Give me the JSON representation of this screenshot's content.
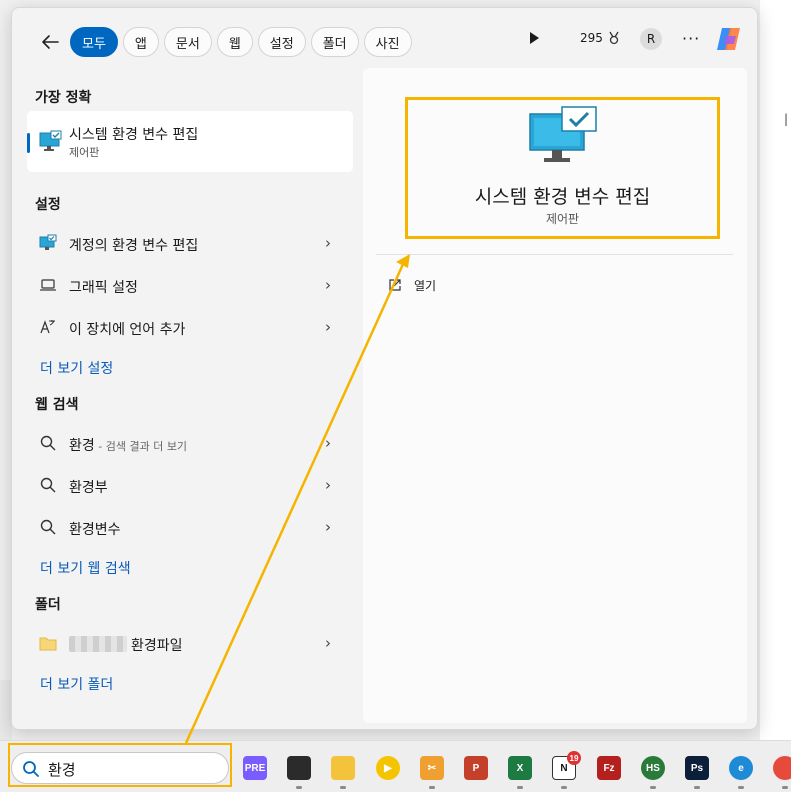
{
  "header": {
    "back_icon": "back-arrow-icon",
    "filters": [
      {
        "label": "모두",
        "active": true
      },
      {
        "label": "앱",
        "active": false
      },
      {
        "label": "문서",
        "active": false
      },
      {
        "label": "웹",
        "active": false
      },
      {
        "label": "설정",
        "active": false
      },
      {
        "label": "폴더",
        "active": false
      },
      {
        "label": "사진",
        "active": false
      }
    ],
    "points": "295",
    "avatar_letter": "R"
  },
  "best_match": {
    "heading": "가장 정확",
    "title": "시스템 환경 변수 편집",
    "subtitle": "제어판"
  },
  "settings": {
    "heading": "설정",
    "items": [
      {
        "label": "계정의 환경 변수 편집",
        "icon": "monitor-check-icon"
      },
      {
        "label": "그래픽 설정",
        "icon": "laptop-icon"
      },
      {
        "label": "이 장치에 언어 추가",
        "icon": "language-icon"
      }
    ],
    "more_link": "더 보기 설정"
  },
  "web": {
    "heading": "웹 검색",
    "items": [
      {
        "label": "환경",
        "suffix": " - 검색 결과 더 보기"
      },
      {
        "label": "환경부",
        "suffix": ""
      },
      {
        "label": "환경변수",
        "suffix": ""
      }
    ],
    "more_link": "더 보기 웹 검색"
  },
  "folders": {
    "heading": "폴더",
    "items": [
      {
        "label": "환경파일"
      }
    ],
    "more_link": "더 보기 폴더"
  },
  "preview": {
    "title": "시스템 환경 변수 편집",
    "subtitle": "제어판",
    "open_label": "열기"
  },
  "taskbar": {
    "search_value": "환경",
    "apps": [
      {
        "name": "copilot-pre",
        "color": "#7b5cff",
        "label": "PRE"
      },
      {
        "name": "task-view",
        "color": "#2b2b2b",
        "label": ""
      },
      {
        "name": "file-explorer",
        "color": "#f3c33b",
        "label": ""
      },
      {
        "name": "media-player",
        "color": "#f5c400",
        "label": "▶"
      },
      {
        "name": "snipping-tool",
        "color": "#f0a030",
        "label": "✂"
      },
      {
        "name": "powerpoint",
        "color": "#c4402a",
        "label": "P"
      },
      {
        "name": "excel",
        "color": "#1d7a43",
        "label": "X"
      },
      {
        "name": "notion",
        "color": "#ffffff",
        "label": "N",
        "badge": "19"
      },
      {
        "name": "filezilla",
        "color": "#b4201e",
        "label": "Fz"
      },
      {
        "name": "hs-app",
        "color": "#2a7a3a",
        "label": "HS"
      },
      {
        "name": "photoshop",
        "color": "#0b1f3a",
        "label": "Ps"
      },
      {
        "name": "edge",
        "color": "#1f8ad6",
        "label": "e"
      },
      {
        "name": "chrome",
        "color": "#e64a3c",
        "label": ""
      }
    ]
  },
  "colors": {
    "accent": "#0067c0",
    "highlight": "#f5b400"
  }
}
